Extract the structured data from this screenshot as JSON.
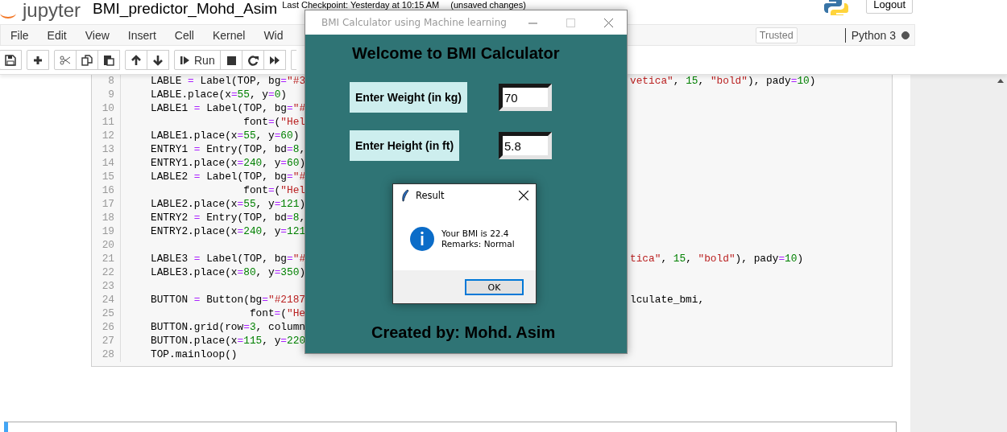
{
  "notebook": {
    "logo": "jupyter",
    "title": "BMI_predictor_Mohd_Asim",
    "checkpoint": "Last Checkpoint: Yesterday at 10:15 AM",
    "save_state": "(unsaved changes)",
    "logout": "Logout"
  },
  "menu": [
    "File",
    "Edit",
    "View",
    "Insert",
    "Cell",
    "Kernel",
    "Wid"
  ],
  "trusted": "Trusted",
  "kernel": {
    "name": "Python 3",
    "busy": true
  },
  "toolbar": [
    {
      "kind": "save"
    },
    {
      "kind": "insert"
    },
    {
      "kind": "cut"
    },
    {
      "kind": "copy"
    },
    {
      "kind": "paste"
    },
    {
      "kind": "up"
    },
    {
      "kind": "down"
    },
    {
      "kind": "run",
      "label": "Run"
    },
    {
      "kind": "stop"
    },
    {
      "kind": "restart"
    },
    {
      "kind": "run-all"
    },
    {
      "kind": "cell-type"
    }
  ],
  "cell": {
    "lines": [
      {
        "number": "8",
        "left": "LABLE = Label(TOP, bg=\"#3",
        "right": "vetica\", 15, \"bold\"), pady=10)",
        "right_in_string": true
      },
      {
        "number": "9",
        "left": "LABLE.place(x=55, y=0)"
      },
      {
        "number": "10",
        "left": "LABLE1 = Label(TOP, bg=\"#"
      },
      {
        "number": "11",
        "left": "               font=(\"Hel"
      },
      {
        "number": "12",
        "left": "LABLE1.place(x=55, y=60)"
      },
      {
        "number": "13",
        "left": "ENTRY1 = Entry(TOP, bd=8,"
      },
      {
        "number": "14",
        "left": "ENTRY1.place(x=240, y=60)"
      },
      {
        "number": "15",
        "left": "LABLE2 = Label(TOP, bg=\"#"
      },
      {
        "number": "16",
        "left": "               font=(\"Hel"
      },
      {
        "number": "17",
        "left": "LABLE2.place(x=55, y=121)"
      },
      {
        "number": "18",
        "left": "ENTRY2 = Entry(TOP, bd=8,"
      },
      {
        "number": "19",
        "left": "ENTRY2.place(x=240, y=121"
      },
      {
        "number": "20"
      },
      {
        "number": "21",
        "left": "LABLE3 = Label(TOP, bg=\"#",
        "right": "tica\", 15, \"bold\"), pady=10)",
        "right_in_string": true
      },
      {
        "number": "22",
        "left": "LABLE3.place(x=80, y=350)"
      },
      {
        "number": "23"
      },
      {
        "number": "24",
        "left": "BUTTON = Button(bg=\"#2187",
        "right": "lculate_bmi,",
        "right_in_string": false
      },
      {
        "number": "25",
        "left": "                font=(\"He"
      },
      {
        "number": "26",
        "left": "BUTTON.grid(row=3, column"
      },
      {
        "number": "27",
        "left": "BUTTON.place(x=115, y=220"
      },
      {
        "number": "28",
        "left": "TOP.mainloop()"
      }
    ]
  },
  "app": {
    "title": "BMI Calculator using Machine learning",
    "heading": "Welcome to BMI Calculator",
    "fields": [
      {
        "label": "Enter Weight (in kg)",
        "value": "70"
      },
      {
        "label": "Enter Height (in ft)",
        "value": "5.8"
      }
    ],
    "credit": "Created by: Mohd. Asim"
  },
  "dialog": {
    "title": "Result",
    "message": [
      "Your BMI is 22.4",
      "Remarks: Normal"
    ],
    "button": "OK"
  }
}
